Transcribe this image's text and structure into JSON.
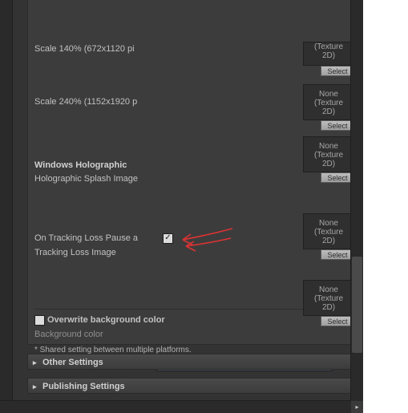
{
  "rows": {
    "scale140_label": "Scale 140% (672x1120 pi",
    "scale240_label": "Scale 240% (1152x1920 p"
  },
  "holographic": {
    "heading": "Windows Holographic",
    "splash_label": "Holographic Splash Image",
    "tracking_pause_label": "On Tracking Loss Pause a",
    "tracking_image_label": "Tracking Loss Image"
  },
  "bg": {
    "overwrite_label": "Overwrite background color",
    "bgcolor_label": "Background color",
    "footnote": "* Shared setting between multiple platforms."
  },
  "foldouts": {
    "other": "Other Settings",
    "publish": "Publishing Settings"
  },
  "slot": {
    "none_line1": "None",
    "none_line2": "(Texture",
    "none_line3": "2D)",
    "select": "Select"
  }
}
